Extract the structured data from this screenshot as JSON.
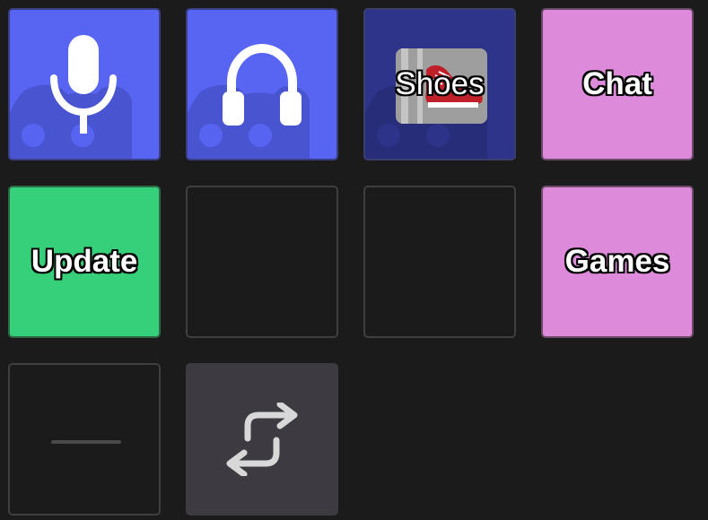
{
  "keys": {
    "mic": {
      "icon": "microphone-icon",
      "bg": "#5865f2"
    },
    "headset": {
      "icon": "headphones-icon",
      "bg": "#5865f2"
    },
    "shoes": {
      "label": "Shoes",
      "icon": "sneaker-icon",
      "bg": "#2d348a"
    },
    "chat": {
      "label": "Chat",
      "bg": "#de8adb"
    },
    "update": {
      "label": "Update",
      "bg": "#37d07a"
    },
    "games": {
      "label": "Games",
      "bg": "#de8adb"
    },
    "divider": {
      "icon": "dash-icon"
    },
    "switch": {
      "icon": "swap-arrows-icon",
      "bg": "#3d3a42"
    }
  }
}
